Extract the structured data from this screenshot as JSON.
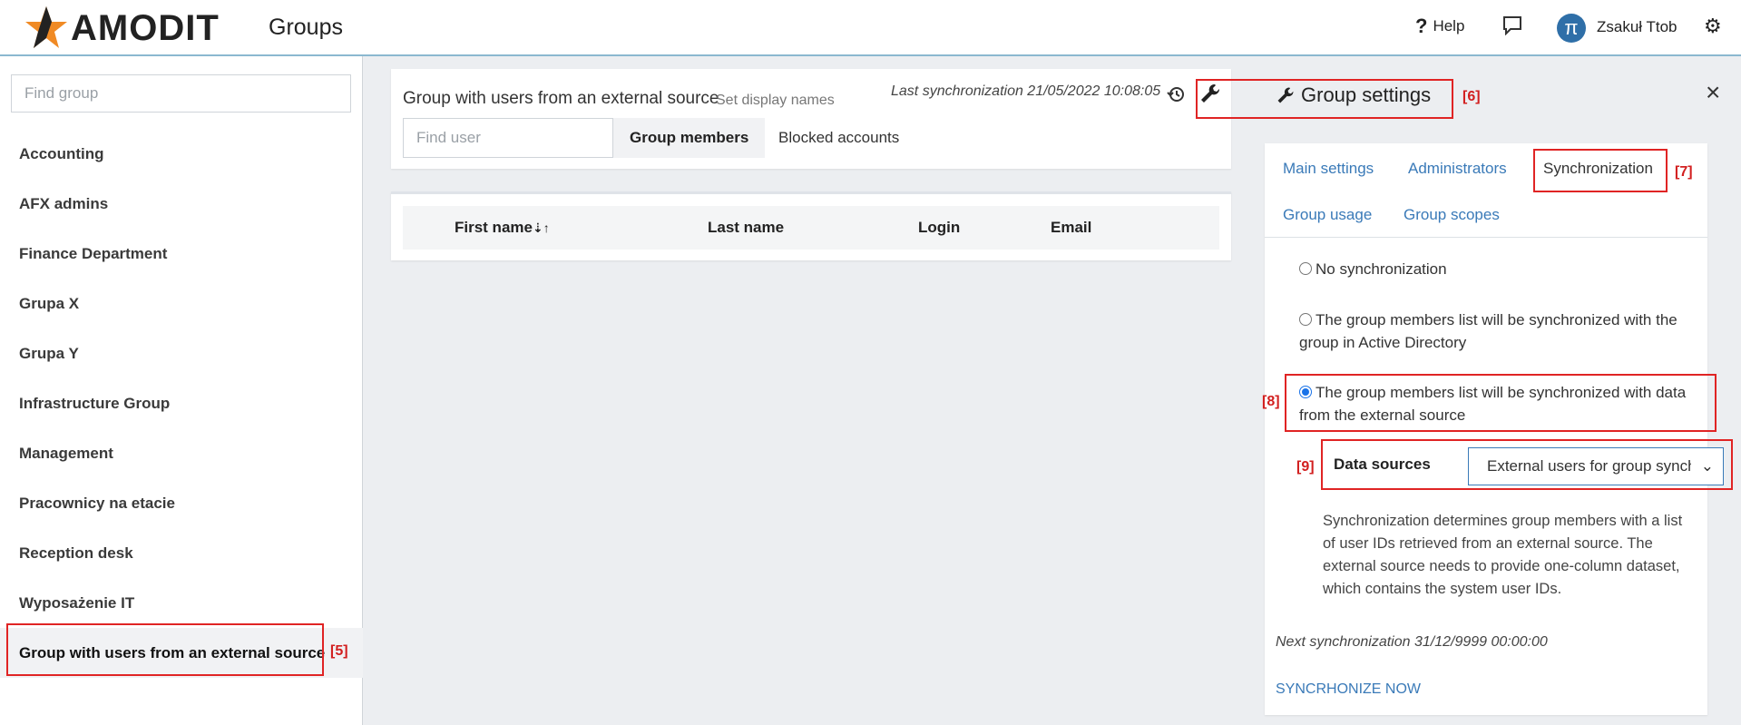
{
  "header": {
    "logo_text": "AMODIT",
    "title": "Groups",
    "help_label": "Help",
    "user_initial": "π",
    "user_name": "Zsakuł Ttob"
  },
  "sidebar": {
    "search_placeholder": "Find group",
    "groups": [
      "Accounting",
      "AFX admins",
      "Finance Department",
      "Grupa X",
      "Grupa Y",
      "Infrastructure Group",
      "Management",
      "Pracownicy na etacie",
      "Reception desk",
      "Wyposażenie IT",
      "Group with users from an external source"
    ],
    "active_index": 10
  },
  "group": {
    "name": "Group with users from an external source",
    "set_display_names": "Set display names",
    "last_sync": "Last synchronization 21/05/2022 10:08:05",
    "find_user_placeholder": "Find user",
    "tab_members": "Group members",
    "tab_blocked": "Blocked accounts",
    "columns": [
      "First name",
      "Last name",
      "Login",
      "Email"
    ]
  },
  "settings": {
    "title": "Group settings",
    "tabs": [
      "Main settings",
      "Administrators",
      "Synchronization",
      "Group usage",
      "Group scopes"
    ],
    "active_tab": "Synchronization",
    "options": [
      "No synchronization",
      "The group members list will be synchronized with the group in Active Directory",
      "The group members list will be synchronized with data from the external source"
    ],
    "selected_option": 2,
    "data_sources_label": "Data sources",
    "data_sources_value": "External users for group synchronization",
    "description": "Synchronization determines group members with a list of user IDs retrieved from an external source. The external source needs to provide one-column dataset, which contains the system user IDs.",
    "next_sync": "Next synchronization 31/12/9999 00:00:00",
    "sync_now": "SYNCRHONIZE NOW"
  },
  "annotations": [
    "[5]",
    "[6]",
    "[7]",
    "[8]",
    "[9]"
  ],
  "colors": {
    "accent_blue": "#3a7ab8",
    "annotation_red": "#e02424",
    "logo_orange": "#f08a24"
  }
}
